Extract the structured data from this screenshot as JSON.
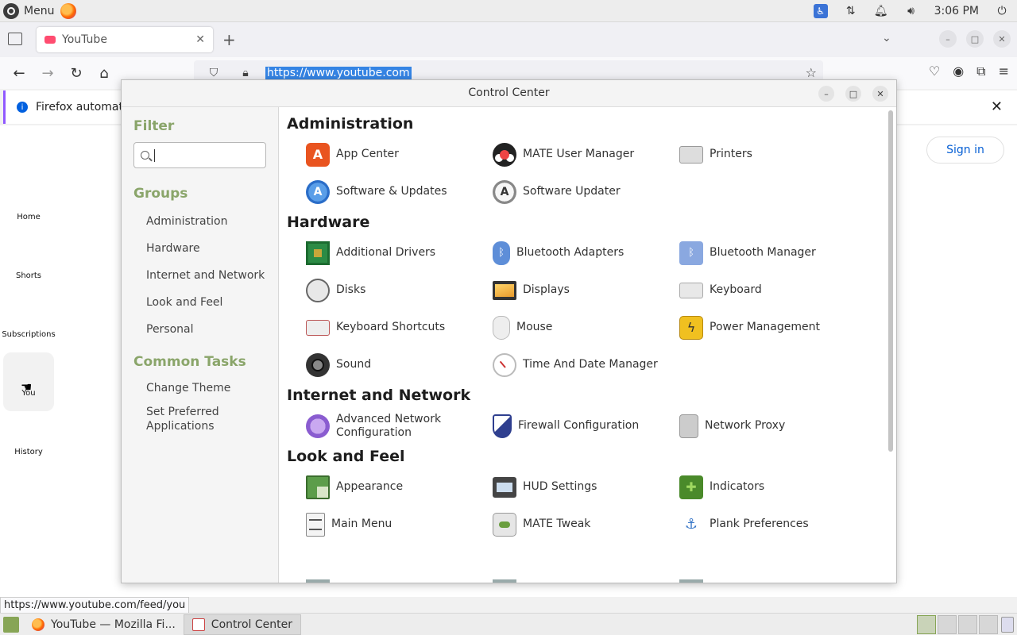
{
  "top_panel": {
    "menu_label": "Menu",
    "clock": "3:06 PM"
  },
  "firefox": {
    "tab_title": "YouTube",
    "url": "https://www.youtube.com",
    "notification": "Firefox automat",
    "status_url": "https://www.youtube.com/feed/you"
  },
  "youtube": {
    "sidebar": [
      "Home",
      "Shorts",
      "Subscriptions",
      "You",
      "History"
    ],
    "sign_in": "Sign in"
  },
  "taskbar": {
    "tasks": [
      "YouTube — Mozilla Fi...",
      "Control Center"
    ]
  },
  "control_center": {
    "title": "Control Center",
    "filter_heading": "Filter",
    "search_placeholder": "",
    "groups_heading": "Groups",
    "groups": [
      "Administration",
      "Hardware",
      "Internet and Network",
      "Look and Feel",
      "Personal"
    ],
    "common_tasks_heading": "Common Tasks",
    "common_tasks": [
      "Change Theme",
      "Set Preferred Applications"
    ],
    "categories": [
      {
        "name": "Administration",
        "items": [
          {
            "label": "App Center",
            "icon": "app-center-icon"
          },
          {
            "label": "MATE User Manager",
            "icon": "user-manager-icon"
          },
          {
            "label": "Printers",
            "icon": "printer-icon"
          },
          {
            "label": "Software & Updates",
            "icon": "software-updates-icon"
          },
          {
            "label": "Software Updater",
            "icon": "software-updater-icon"
          }
        ]
      },
      {
        "name": "Hardware",
        "items": [
          {
            "label": "Additional Drivers",
            "icon": "chip-icon"
          },
          {
            "label": "Bluetooth Adapters",
            "icon": "bluetooth-icon"
          },
          {
            "label": "Bluetooth Manager",
            "icon": "bluetooth-manager-icon"
          },
          {
            "label": "Disks",
            "icon": "disk-icon"
          },
          {
            "label": "Displays",
            "icon": "display-icon"
          },
          {
            "label": "Keyboard",
            "icon": "keyboard-icon"
          },
          {
            "label": "Keyboard Shortcuts",
            "icon": "keyboard-shortcuts-icon"
          },
          {
            "label": "Mouse",
            "icon": "mouse-icon"
          },
          {
            "label": "Power Management",
            "icon": "power-icon"
          },
          {
            "label": "Sound",
            "icon": "speaker-icon"
          },
          {
            "label": "Time And Date Manager",
            "icon": "clock-icon"
          }
        ]
      },
      {
        "name": "Internet and Network",
        "items": [
          {
            "label": "Advanced Network Configuration",
            "icon": "network-icon"
          },
          {
            "label": "Firewall Configuration",
            "icon": "firewall-icon"
          },
          {
            "label": "Network Proxy",
            "icon": "proxy-icon"
          }
        ]
      },
      {
        "name": "Look and Feel",
        "items": [
          {
            "label": "Appearance",
            "icon": "appearance-icon"
          },
          {
            "label": "HUD Settings",
            "icon": "hud-icon"
          },
          {
            "label": "Indicators",
            "icon": "indicators-icon"
          },
          {
            "label": "Main Menu",
            "icon": "main-menu-icon"
          },
          {
            "label": "MATE Tweak",
            "icon": "tweak-icon"
          },
          {
            "label": "Plank Preferences",
            "icon": "plank-icon"
          }
        ]
      }
    ]
  }
}
